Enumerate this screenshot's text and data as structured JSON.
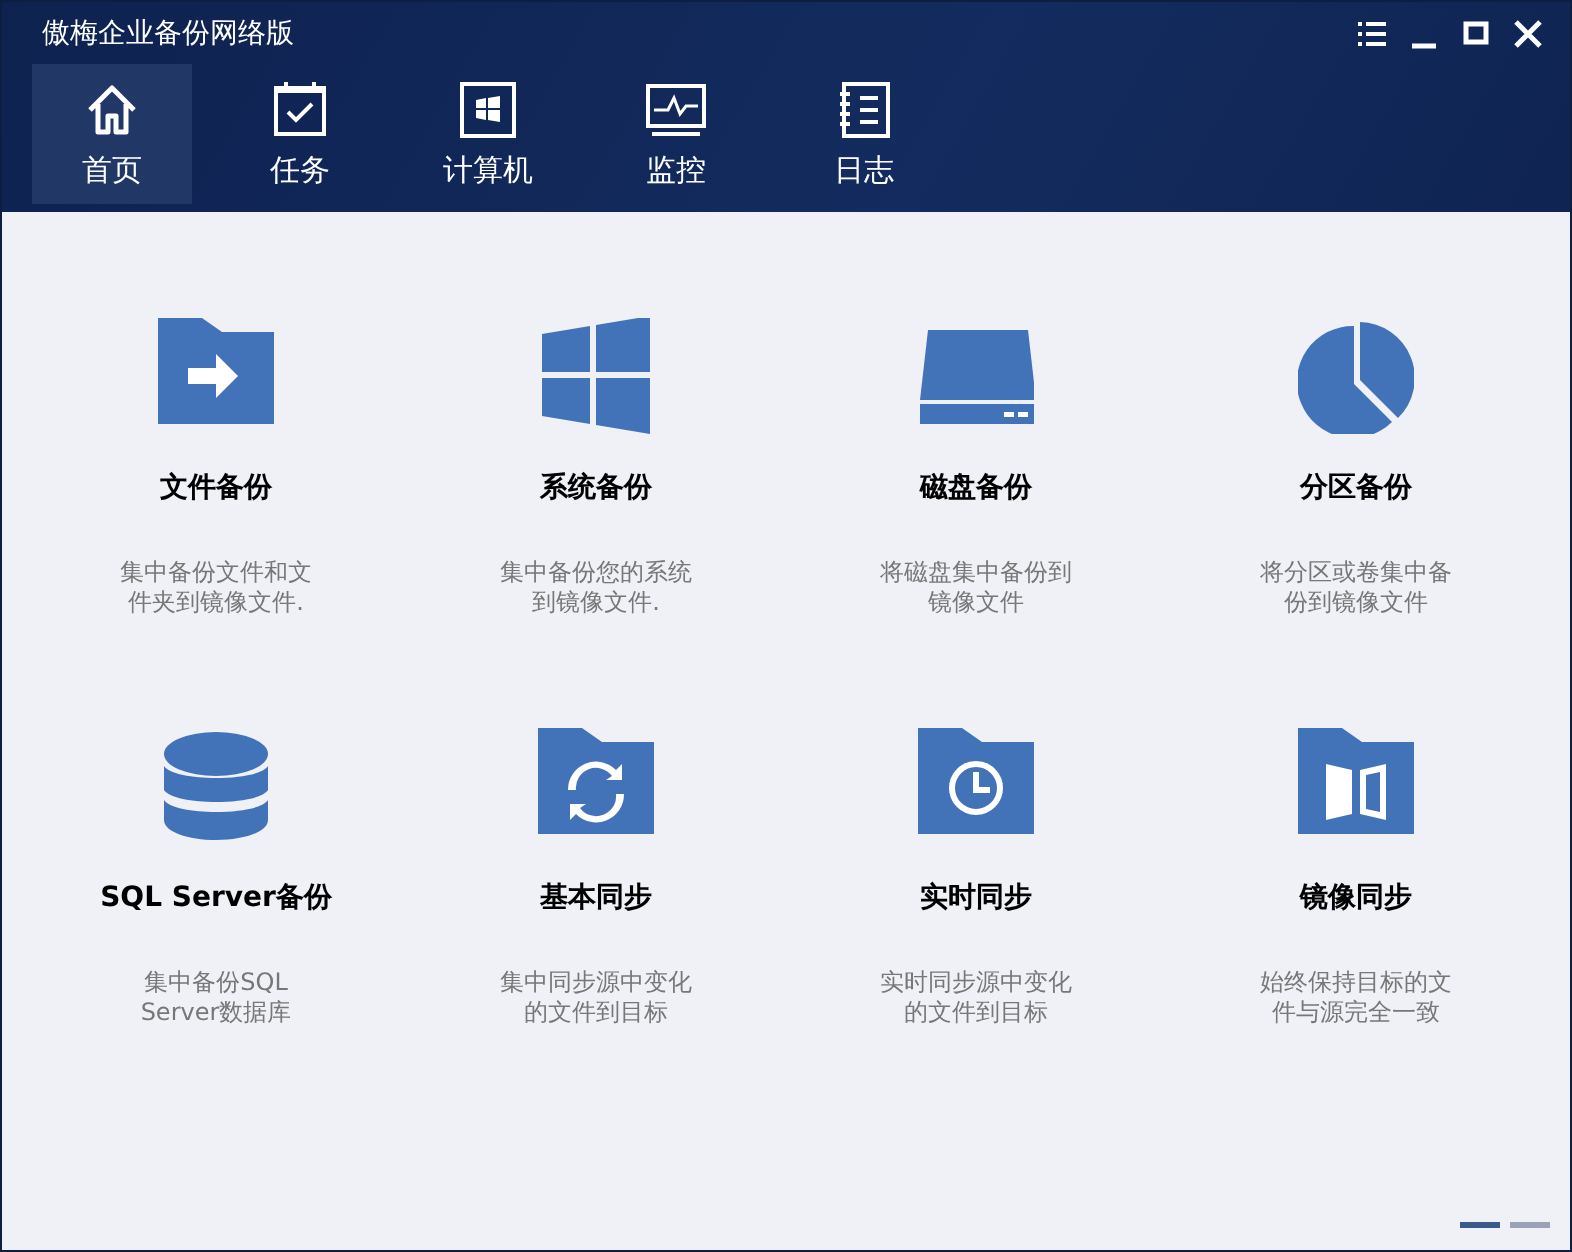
{
  "window": {
    "title": "傲梅企业备份网络版"
  },
  "tabs": [
    {
      "label": "首页",
      "kind": "home",
      "selected": true
    },
    {
      "label": "任务",
      "kind": "task",
      "selected": false
    },
    {
      "label": "计算机",
      "kind": "computer",
      "selected": false
    },
    {
      "label": "监控",
      "kind": "monitor",
      "selected": false
    },
    {
      "label": "日志",
      "kind": "log",
      "selected": false
    }
  ],
  "features": [
    {
      "kind": "file",
      "title": "文件备份",
      "description": "集中备份文件和文件夹到镜像文件."
    },
    {
      "kind": "system",
      "title": "系统备份",
      "description": "集中备份您的系统到镜像文件."
    },
    {
      "kind": "disk",
      "title": "磁盘备份",
      "description": "将磁盘集中备份到镜像文件"
    },
    {
      "kind": "partition",
      "title": "分区备份",
      "description": "将分区或卷集中备份到镜像文件"
    },
    {
      "kind": "sql",
      "title": "SQL Server备份",
      "description": "集中备份SQL Server数据库"
    },
    {
      "kind": "sync",
      "title": "基本同步",
      "description": "集中同步源中变化的文件到目标"
    },
    {
      "kind": "realtime",
      "title": "实时同步",
      "description": "实时同步源中变化的文件到目标"
    },
    {
      "kind": "mirror",
      "title": "镜像同步",
      "description": "始终保持目标的文件与源完全一致"
    }
  ],
  "pages": [
    {
      "selected": true
    },
    {
      "selected": false
    }
  ]
}
